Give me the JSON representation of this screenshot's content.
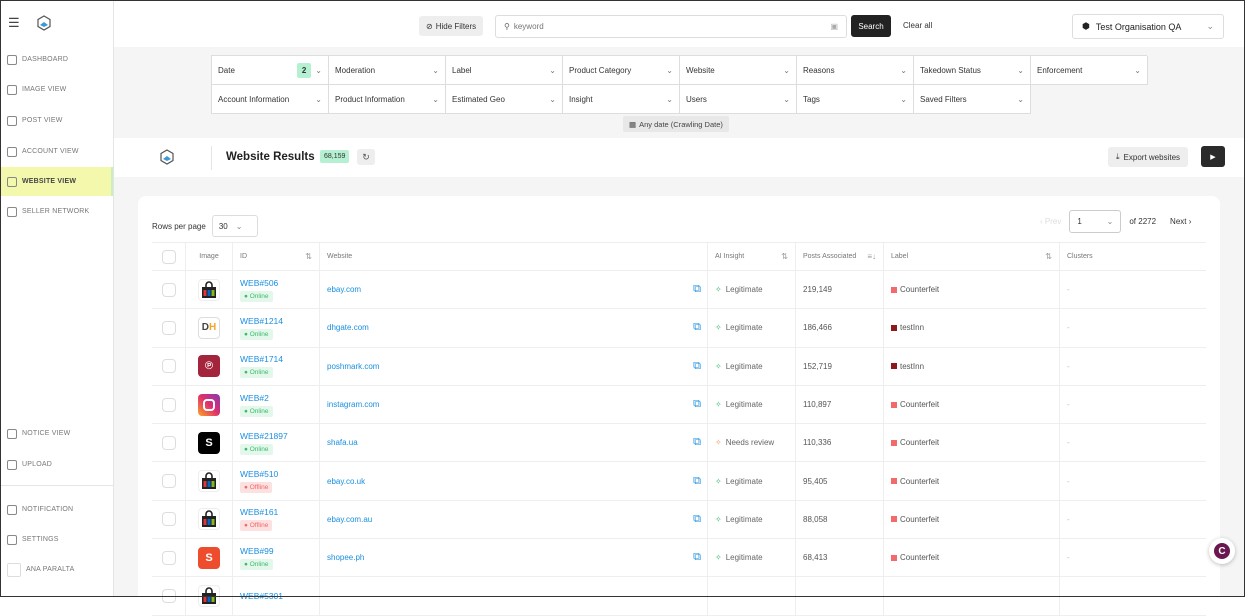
{
  "sidebar": {
    "items": [
      {
        "label": "DASHBOARD",
        "icon": "dashboard-icon"
      },
      {
        "label": "IMAGE VIEW",
        "icon": "image-icon"
      },
      {
        "label": "POST VIEW",
        "icon": "document-icon"
      },
      {
        "label": "ACCOUNT VIEW",
        "icon": "user-circle-icon"
      },
      {
        "label": "WEBSITE VIEW",
        "icon": "browser-icon",
        "active": true
      },
      {
        "label": "SELLER NETWORK",
        "icon": "network-icon"
      }
    ],
    "bottom": [
      {
        "label": "NOTICE VIEW",
        "icon": "notice-icon"
      },
      {
        "label": "UPLOAD",
        "icon": "upload-icon"
      },
      {
        "label": "NOTIFICATION",
        "icon": "bell-icon"
      },
      {
        "label": "SETTINGS",
        "icon": "gear-icon"
      },
      {
        "label": "ANA PARALTA",
        "icon": "avatar"
      }
    ]
  },
  "topbar": {
    "hide_filters": "Hide Filters",
    "search_placeholder": "keyword",
    "search_button": "Search",
    "clear_all": "Clear all",
    "organisation": "Test Organisation QA"
  },
  "filters": [
    {
      "label": "Date",
      "badge": "2"
    },
    {
      "label": "Moderation"
    },
    {
      "label": "Label"
    },
    {
      "label": "Product Category"
    },
    {
      "label": "Website"
    },
    {
      "label": "Reasons"
    },
    {
      "label": "Takedown Status"
    },
    {
      "label": "Enforcement"
    },
    {
      "label": "Account Information"
    },
    {
      "label": "Product Information"
    },
    {
      "label": "Estimated Geo"
    },
    {
      "label": "Insight"
    },
    {
      "label": "Users"
    },
    {
      "label": "Tags"
    },
    {
      "label": "Saved Filters"
    }
  ],
  "any_date": "Any date (Crawling Date)",
  "results": {
    "title": "Website Results",
    "count": "68,159",
    "export": "Export websites"
  },
  "pagination": {
    "rows_per_page_label": "Rows per page",
    "rows_per_page": "30",
    "prev": "Prev",
    "page": "1",
    "of": "of 2272",
    "next": "Next"
  },
  "columns": [
    "Image",
    "ID",
    "Website",
    "AI Insight",
    "Posts Associated",
    "Label",
    "Clusters"
  ],
  "colors": {
    "accent": "#1a8fe0",
    "active_nav": "#f3f8ad",
    "badge": "#b6f0d2",
    "counterfeit": "#f26b6b",
    "testinn": "#8b1a1a"
  },
  "rows": [
    {
      "logo": "ebay",
      "id": "WEB#506",
      "status": "Online",
      "website": "ebay.com",
      "insight": "Legitimate",
      "posts": "219,149",
      "label": "Counterfeit",
      "clusters": "-"
    },
    {
      "logo": "dhgate",
      "id": "WEB#1214",
      "status": "Online",
      "website": "dhgate.com",
      "insight": "Legitimate",
      "posts": "186,466",
      "label": "testInn",
      "clusters": "-"
    },
    {
      "logo": "poshmark",
      "id": "WEB#1714",
      "status": "Online",
      "website": "poshmark.com",
      "insight": "Legitimate",
      "posts": "152,719",
      "label": "testInn",
      "clusters": "-"
    },
    {
      "logo": "instagram",
      "id": "WEB#2",
      "status": "Online",
      "website": "instagram.com",
      "insight": "Legitimate",
      "posts": "110,897",
      "label": "Counterfeit",
      "clusters": "-"
    },
    {
      "logo": "shafa",
      "id": "WEB#21897",
      "status": "Online",
      "website": "shafa.ua",
      "insight": "Needs review",
      "posts": "110,336",
      "label": "Counterfeit",
      "clusters": "-"
    },
    {
      "logo": "ebay",
      "id": "WEB#510",
      "status": "Offline",
      "website": "ebay.co.uk",
      "insight": "Legitimate",
      "posts": "95,405",
      "label": "Counterfeit",
      "clusters": "-"
    },
    {
      "logo": "ebay",
      "id": "WEB#161",
      "status": "Offline",
      "website": "ebay.com.au",
      "insight": "Legitimate",
      "posts": "88,058",
      "label": "Counterfeit",
      "clusters": "-"
    },
    {
      "logo": "shopee",
      "id": "WEB#99",
      "status": "Online",
      "website": "shopee.ph",
      "insight": "Legitimate",
      "posts": "68,413",
      "label": "Counterfeit",
      "clusters": "-"
    },
    {
      "logo": "ebay",
      "id": "WEB#5301",
      "status": "",
      "website": "",
      "insight": "",
      "posts": "",
      "label": "",
      "clusters": ""
    }
  ]
}
